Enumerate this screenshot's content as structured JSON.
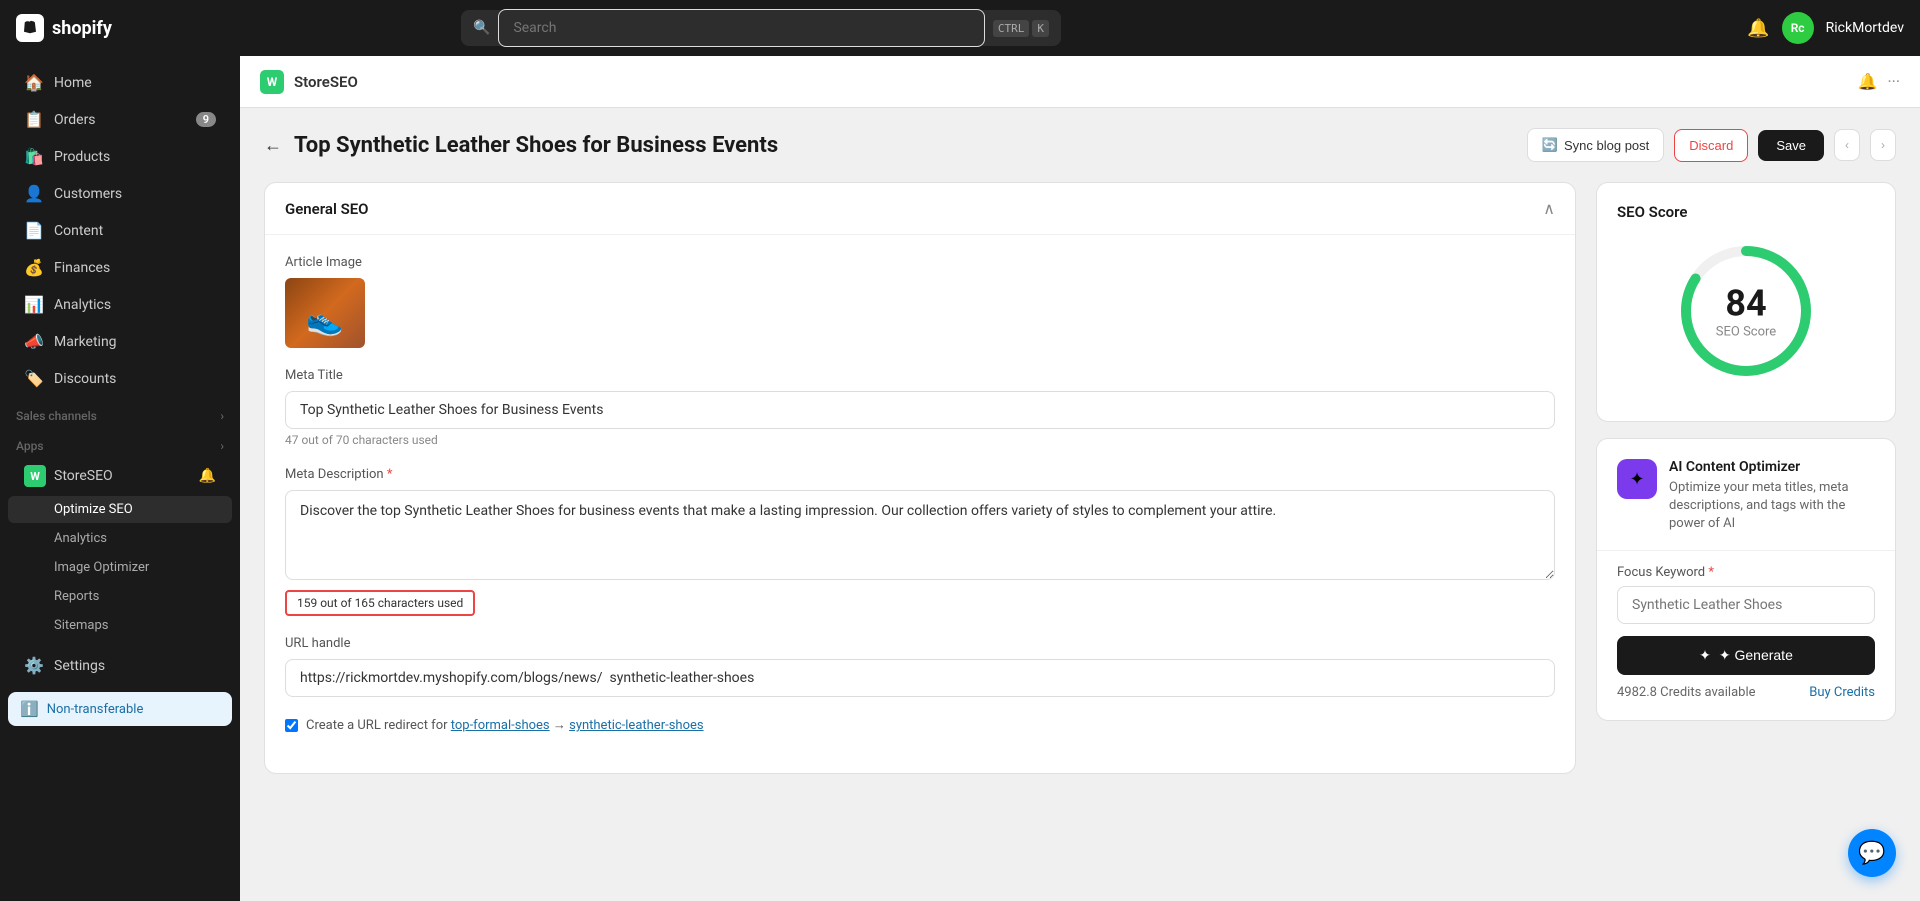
{
  "topbar": {
    "logo_text": "shopify",
    "search_placeholder": "Search",
    "kbd_ctrl": "CTRL",
    "kbd_k": "K",
    "bell_label": "notifications",
    "avatar_text": "Rc",
    "username": "RickMortdev"
  },
  "sidebar": {
    "nav_items": [
      {
        "id": "home",
        "icon": "🏠",
        "label": "Home",
        "badge": null,
        "active": false
      },
      {
        "id": "orders",
        "icon": "📋",
        "label": "Orders",
        "badge": "9",
        "active": false
      },
      {
        "id": "products",
        "icon": "🛍️",
        "label": "Products",
        "badge": null,
        "active": false
      },
      {
        "id": "customers",
        "icon": "👤",
        "label": "Customers",
        "badge": null,
        "active": false
      },
      {
        "id": "content",
        "icon": "📄",
        "label": "Content",
        "badge": null,
        "active": false
      },
      {
        "id": "finances",
        "icon": "💰",
        "label": "Finances",
        "badge": null,
        "active": false
      },
      {
        "id": "analytics",
        "icon": "📊",
        "label": "Analytics",
        "badge": null,
        "active": false
      },
      {
        "id": "marketing",
        "icon": "📣",
        "label": "Marketing",
        "badge": null,
        "active": false
      },
      {
        "id": "discounts",
        "icon": "🏷️",
        "label": "Discounts",
        "badge": null,
        "active": false
      }
    ],
    "sales_channels_label": "Sales channels",
    "apps_label": "Apps",
    "storeseo_label": "StoreSEO",
    "optimize_seo_label": "Optimize SEO",
    "sub_items": [
      {
        "id": "analytics",
        "label": "Analytics"
      },
      {
        "id": "image-optimizer",
        "label": "Image Optimizer"
      },
      {
        "id": "reports",
        "label": "Reports"
      },
      {
        "id": "sitemaps",
        "label": "Sitemaps"
      }
    ],
    "settings_label": "Settings",
    "non_transferable_label": "Non-transferable"
  },
  "app_header": {
    "storeseo_label": "StoreSEO",
    "logo_letter": "W"
  },
  "page": {
    "back_label": "←",
    "title": "Top Synthetic Leather Shoes for Business Events",
    "sync_label": "Sync blog post",
    "discard_label": "Discard",
    "save_label": "Save",
    "general_seo_label": "General SEO",
    "article_image_label": "Article Image",
    "meta_title_label": "Meta Title",
    "meta_title_value": "Top Synthetic Leather Shoes for Business Events",
    "meta_title_char_count": "47 out of 70 characters used",
    "meta_desc_label": "Meta Description",
    "meta_desc_required": true,
    "meta_desc_value": "Discover the top Synthetic Leather Shoes for business events that make a lasting impression. Our collection offers variety of styles to complement your attire.",
    "meta_desc_char_count": "159 out of 165 characters used",
    "url_handle_label": "URL handle",
    "url_value": "https://rickmortdev.myshopify.com/blogs/news/  synthetic-leather-shoes",
    "url_prefix": "https://rickmortdev.myshopify.com/blogs/news/",
    "url_slug": "synthetic-leather-shoes",
    "url_redirect_label": "Create a URL redirect for",
    "url_redirect_from": "top-formal-shoes",
    "url_redirect_to": "synthetic-leather-shoes"
  },
  "seo_score": {
    "title": "SEO Score",
    "score": 84,
    "score_label": "SEO Score",
    "circle_dashoffset": 60,
    "score_percent": 84
  },
  "ai_optimizer": {
    "title": "AI Content Optimizer",
    "description": "Optimize your meta titles, meta descriptions, and tags with the power of AI",
    "focus_keyword_label": "Focus Keyword",
    "focus_keyword_required": true,
    "focus_keyword_placeholder": "Synthetic Leather Shoes",
    "generate_label": "✦ Generate",
    "credits_label": "4982.8 Credits available",
    "buy_credits_label": "Buy Credits"
  },
  "chat": {
    "icon": "💬"
  }
}
